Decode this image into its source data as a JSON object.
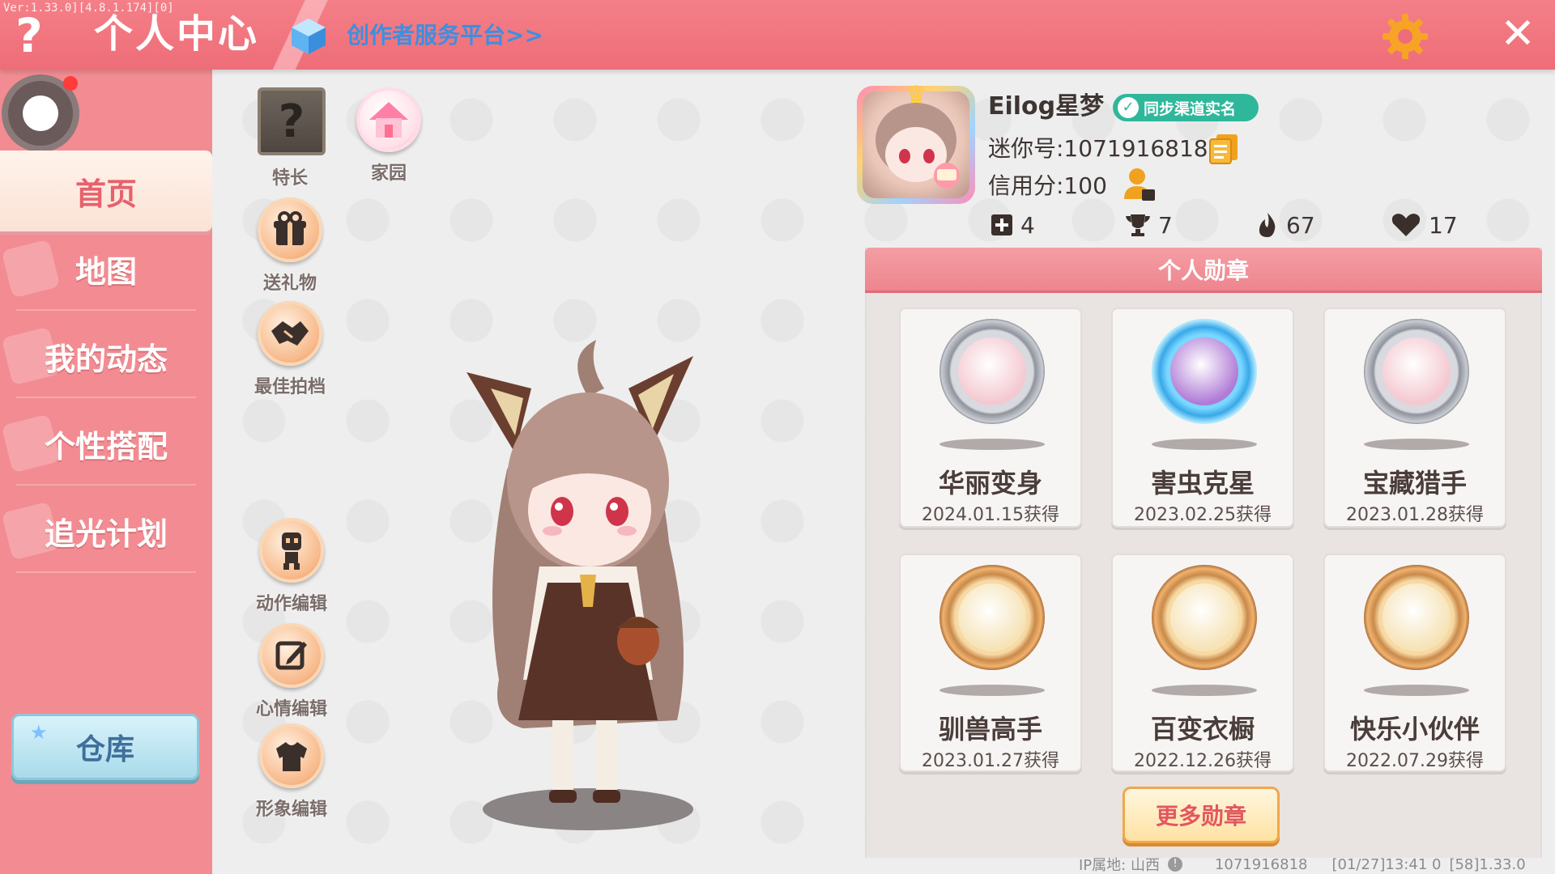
{
  "header": {
    "version_text": "Ver:1.33.0][4.8.1.174][0]",
    "help_icon": "question-mark-icon",
    "title": "个人中心",
    "creator_link": "创作者服务平台>>",
    "settings_icon": "gear-icon",
    "close_icon": "close-icon"
  },
  "sidebar": {
    "items": [
      {
        "label": "首页",
        "active": true
      },
      {
        "label": "地图",
        "active": false
      },
      {
        "label": "我的动态",
        "active": false
      },
      {
        "label": "个性搭配",
        "active": false
      },
      {
        "label": "追光计划",
        "active": false
      }
    ],
    "warehouse_label": "仓库"
  },
  "actions": {
    "talent": "特长",
    "talent_glyph": "?",
    "home": "家园",
    "gift": "送礼物",
    "partner": "最佳拍档",
    "motion_edit": "动作编辑",
    "mood_edit": "心情编辑",
    "look_edit": "形象编辑"
  },
  "profile": {
    "username": "Eilog星梦",
    "verify_badge": "同步渠道实名",
    "mini_id": "迷你号:1071916818",
    "credit": "信用分:100",
    "stats": [
      {
        "icon": "plus-square-icon",
        "value": "4"
      },
      {
        "icon": "trophy-icon",
        "value": "7"
      },
      {
        "icon": "flame-icon",
        "value": "67"
      },
      {
        "icon": "heart-icon",
        "value": "17"
      }
    ]
  },
  "medals": {
    "header": "个人勋章",
    "items": [
      {
        "name": "华丽变身",
        "date": "2024.01.15获得",
        "style": "silver"
      },
      {
        "name": "害虫克星",
        "date": "2023.02.25获得",
        "style": "crystal"
      },
      {
        "name": "宝藏猎手",
        "date": "2023.01.28获得",
        "style": "silver"
      },
      {
        "name": "驯兽高手",
        "date": "2023.01.27获得",
        "style": "bronze"
      },
      {
        "name": "百变衣橱",
        "date": "2022.12.26获得",
        "style": "bronze"
      },
      {
        "name": "快乐小伙伴",
        "date": "2022.07.29获得",
        "style": "bronze"
      }
    ],
    "more_button": "更多勋章"
  },
  "footer": {
    "ip_location": "IP属地: 山西",
    "uid": "1071916818",
    "timestamp": "[01/27]13:41 0",
    "build": "[58]1.33.0"
  },
  "colors": {
    "topbar": "#ee6d78",
    "sidebar": "#f28c92",
    "accent_red": "#e2575f",
    "verify_green": "#2fb79b",
    "link_blue": "#3d8fe0"
  }
}
